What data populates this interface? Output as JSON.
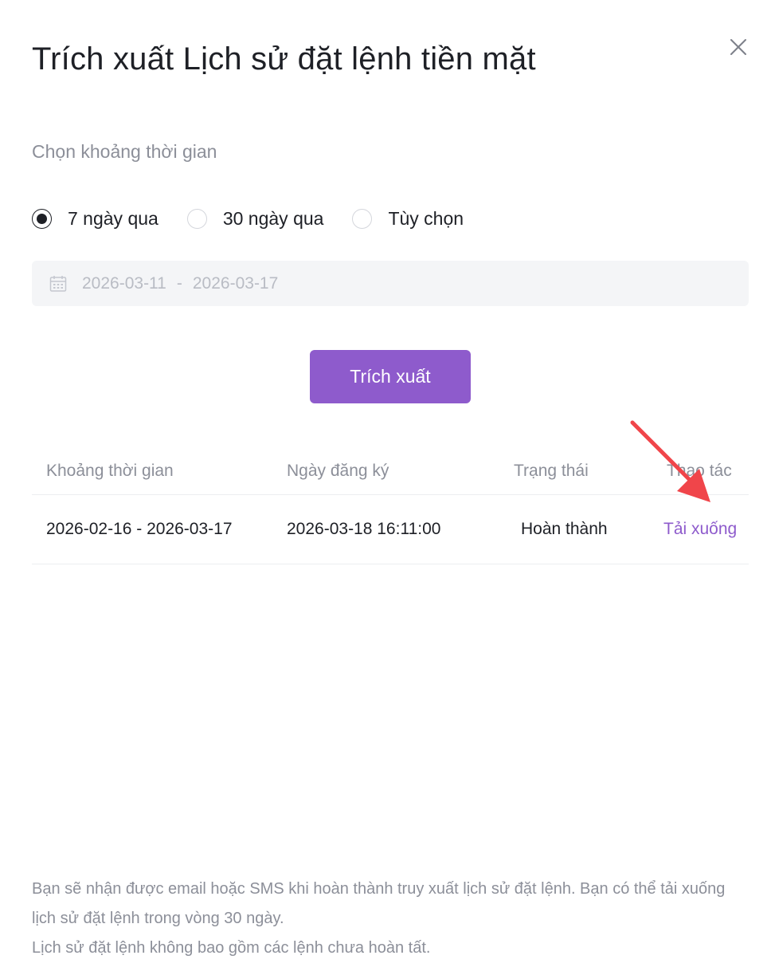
{
  "dialog": {
    "title": "Trích xuất Lịch sử đặt lệnh tiền mặt",
    "close_icon": "close-icon"
  },
  "period": {
    "label": "Chọn khoảng thời gian",
    "options": [
      {
        "label": "7 ngày qua",
        "checked": true
      },
      {
        "label": "30 ngày qua",
        "checked": false
      },
      {
        "label": "Tùy chọn",
        "checked": false
      }
    ],
    "date_range": {
      "icon": "calendar-icon",
      "start": "2026-03-11",
      "separator": "-",
      "end": "2026-03-17"
    }
  },
  "extract_button": {
    "label": "Trích xuất",
    "color": "#8e5bcc"
  },
  "table": {
    "columns": [
      "Khoảng thời gian",
      "Ngày đăng ký",
      "Trạng thái",
      "Thao tác"
    ],
    "rows": [
      {
        "period": "2026-02-16 - 2026-03-17",
        "registered": "2026-03-18 16:11:00",
        "status": "Hoàn thành",
        "action": "Tải xuống"
      }
    ]
  },
  "annotation": {
    "arrow_color": "#f0454a"
  },
  "footnote": {
    "line1": "Bạn sẽ nhận được email hoặc SMS khi hoàn thành truy xuất lịch sử đặt lệnh. Bạn có thể tải xuống lịch sử đặt lệnh trong vòng 30 ngày.",
    "line2": "Lịch sử đặt lệnh không bao gồm các lệnh chưa hoàn tất."
  }
}
